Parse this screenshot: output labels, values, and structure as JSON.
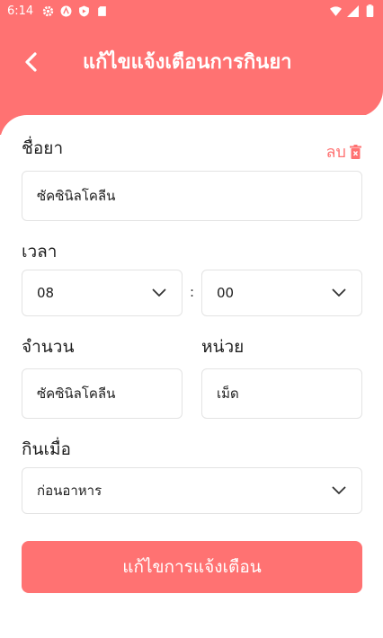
{
  "status_bar": {
    "time": "6:14"
  },
  "header": {
    "title": "แก้ไขแจ้งเตือนการกินยา"
  },
  "form": {
    "drug_name": {
      "label": "ชื่อยา",
      "value": "ซัคซินิลโคลีน",
      "delete_label": "ลบ"
    },
    "time": {
      "label": "เวลา",
      "hour": "08",
      "separator": ":",
      "minute": "00"
    },
    "amount": {
      "label": "จำนวน",
      "value": "ซัคซินิลโคลีน"
    },
    "unit": {
      "label": "หน่วย",
      "value": "เม็ด"
    },
    "when": {
      "label": "กินเมื่อ",
      "value": "ก่อนอาหาร"
    }
  },
  "submit": {
    "label": "แก้ไขการแจ้งเตือน"
  },
  "colors": {
    "accent": "#ff7272",
    "border": "#e3e3e3",
    "text": "#1e1e1e"
  }
}
